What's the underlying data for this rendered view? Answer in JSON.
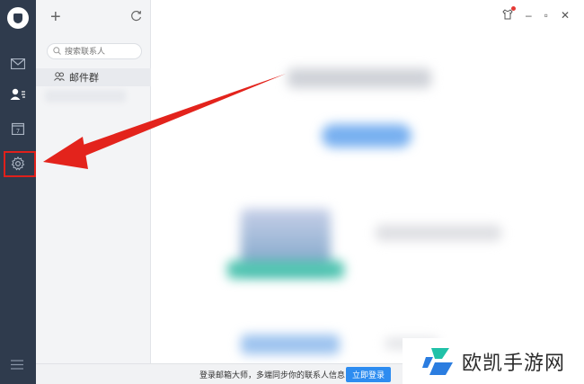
{
  "contacts": {
    "search_placeholder": "搜索联系人",
    "group_label": "邮件群"
  },
  "bottom_bar": {
    "message": "登录邮箱大师，多端同步你的联系人信息",
    "login_label": "立即登录"
  },
  "watermark": {
    "text": "欧凯手游网"
  },
  "colors": {
    "rail": "#2f3b4d",
    "accent": "#2d8cf0",
    "highlight": "#e0201b"
  },
  "icons": [
    "logo-icon",
    "mail-icon",
    "contacts-icon",
    "calendar-icon",
    "settings-icon",
    "menu-icon",
    "plus-icon",
    "refresh-icon",
    "search-icon",
    "group-icon",
    "shirt-icon",
    "minimize-icon",
    "maximize-icon",
    "close-icon"
  ]
}
